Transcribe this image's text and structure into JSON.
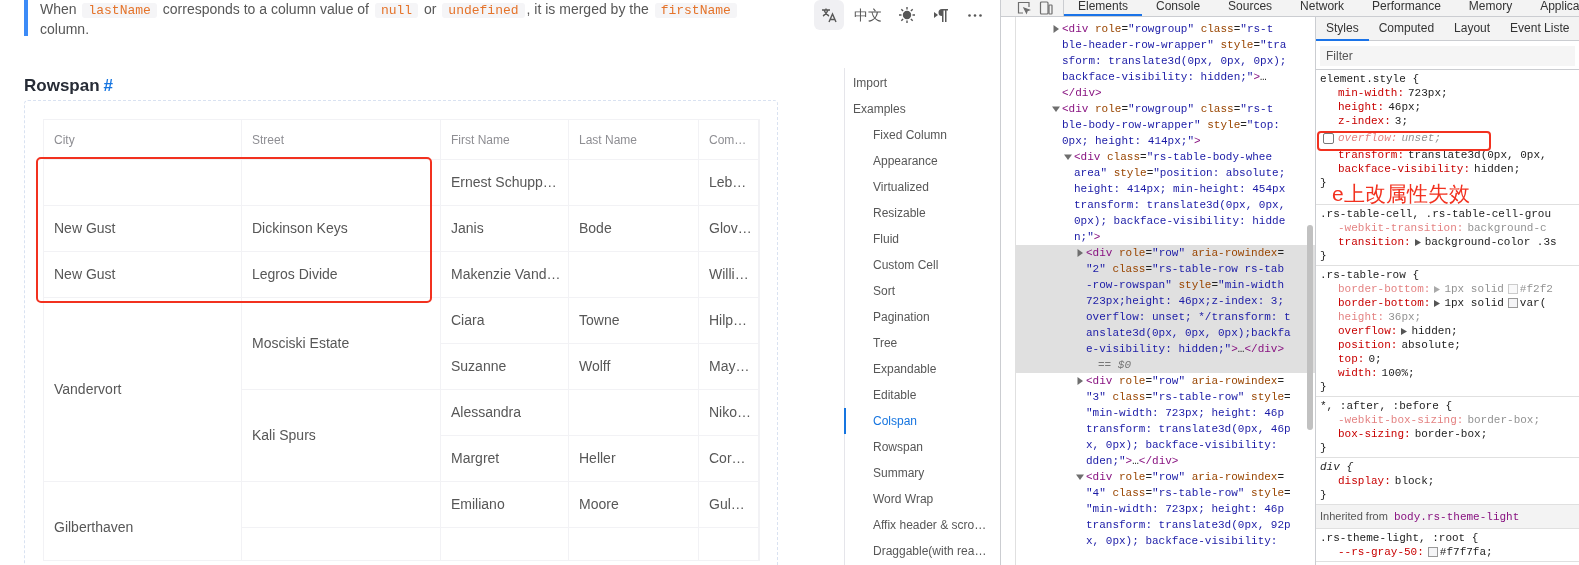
{
  "doc": {
    "note": [
      {
        "text": "When "
      },
      {
        "code": "lastName"
      },
      {
        "text": " corresponds to a column value of "
      },
      {
        "code": "null"
      },
      {
        "text": " or "
      },
      {
        "code": "undefined"
      },
      {
        "text": ", it is merged by the "
      },
      {
        "code": "firstName"
      },
      {
        "text": " column."
      }
    ],
    "toolbar": [
      {
        "kind": "translate",
        "selected": true
      },
      {
        "kind": "language",
        "label": "中文",
        "selected": false
      },
      {
        "kind": "theme",
        "selected": false
      },
      {
        "kind": "direction",
        "selected": false
      },
      {
        "kind": "more",
        "selected": false
      }
    ],
    "heading": {
      "title": "Rowspan",
      "anchor": "#"
    },
    "table": {
      "columns": [
        "City",
        "Street",
        "First Name",
        "Last Name",
        "Com…"
      ],
      "groups": [
        {
          "streets": [
            {
              "people": [
                {
                  "first_name": "Ernest Schupp…",
                  "company": "Leb…"
                }
              ]
            }
          ]
        },
        {
          "city": "New Gust",
          "streets": [
            {
              "street": "Dickinson Keys",
              "people": [
                {
                  "first_name": "Janis",
                  "last_name": "Bode",
                  "company": "Glov…"
                }
              ]
            }
          ]
        },
        {
          "city": "New Gust",
          "streets": [
            {
              "street": "Legros Divide",
              "people": [
                {
                  "first_name": "Makenzie Vand…",
                  "company": "Willi…"
                }
              ]
            }
          ]
        },
        {
          "city": "Vandervort",
          "streets": [
            {
              "street": "Mosciski Estate",
              "people": [
                {
                  "first_name": "Ciara",
                  "last_name": "Towne",
                  "company": "Hilp…"
                },
                {
                  "first_name": "Suzanne",
                  "last_name": "Wolff",
                  "company": "May…"
                }
              ]
            },
            {
              "street": "Kali Spurs",
              "people": [
                {
                  "first_name": "Alessandra",
                  "company": "Niko…"
                },
                {
                  "first_name": "Margret",
                  "last_name": "Heller",
                  "company": "Cor…"
                }
              ]
            }
          ]
        },
        {
          "city": "Gilberthaven",
          "streets": [
            {
              "people": [
                {
                  "first_name": "Emiliano",
                  "last_name": "Moore",
                  "company": "Gul…"
                }
              ]
            }
          ]
        }
      ]
    },
    "toc": [
      {
        "label": "Import",
        "selected": false
      },
      {
        "label": "Examples",
        "selected": false,
        "children": [
          {
            "label": "Fixed Column",
            "selected": false
          },
          {
            "label": "Appearance",
            "selected": false
          },
          {
            "label": "Virtualized",
            "selected": false
          },
          {
            "label": "Resizable",
            "selected": false
          },
          {
            "label": "Fluid",
            "selected": false
          },
          {
            "label": "Custom Cell",
            "selected": false
          },
          {
            "label": "Sort",
            "selected": false
          },
          {
            "label": "Pagination",
            "selected": false
          },
          {
            "label": "Tree",
            "selected": false
          },
          {
            "label": "Expandable",
            "selected": false
          },
          {
            "label": "Editable",
            "selected": false
          },
          {
            "label": "Colspan",
            "selected": true
          },
          {
            "label": "Rowspan",
            "selected": false
          },
          {
            "label": "Summary",
            "selected": false
          },
          {
            "label": "Word Wrap",
            "selected": false
          },
          {
            "label": "Affix header & scro…",
            "selected": false
          },
          {
            "label": "Draggable(with rea…",
            "selected": false
          }
        ]
      }
    ]
  },
  "devtools": {
    "tools": [
      {
        "kind": "inspect"
      },
      {
        "kind": "device"
      }
    ],
    "tabs": [
      {
        "label": "Elements",
        "selected": true
      },
      {
        "label": "Console",
        "selected": false
      },
      {
        "label": "Sources",
        "selected": false
      },
      {
        "label": "Network",
        "selected": false
      },
      {
        "label": "Performance",
        "selected": false
      },
      {
        "label": "Memory",
        "selected": false
      },
      {
        "label": "Applica",
        "selected": false
      }
    ],
    "dom": [
      {
        "expanded": false,
        "selected": false,
        "lines": [
          "<div role=\"rowgroup\" class=\"rs-t",
          "ble-header-row-wrapper\" style=\"tra",
          "sform: translate3d(0px, 0px, 0px);",
          "backface-visibility: hidden;\">…",
          "</div>"
        ]
      },
      {
        "expanded": true,
        "selected": false,
        "lines": [
          "<div role=\"rowgroup\" class=\"rs-t",
          "ble-body-row-wrapper\" style=\"top:",
          "0px; height: 414px;\">"
        ],
        "children": [
          {
            "expanded": true,
            "selected": false,
            "lines": [
              "<div class=\"rs-table-body-whee",
              "area\" style=\"position: absolute;",
              "height: 414px; min-height: 454px",
              "transform: translate3d(0px, 0px,",
              "0px); backface-visibility: hidde",
              "n;\">"
            ],
            "children": [
              {
                "expanded": false,
                "selected": true,
                "ref": "== $0",
                "lines": [
                  "<div role=\"row\" aria-rowindex=",
                  "\"2\" class=\"rs-table-row rs-tab",
                  "-row-rowspan\" style=\"min-width",
                  "723px;height: 46px;z-index: 3;",
                  "overflow: unset; */transform: t",
                  "anslate3d(0px, 0px, 0px);backfa",
                  "e-visibility: hidden;\">…</div>"
                ]
              },
              {
                "expanded": false,
                "selected": false,
                "lines": [
                  "<div role=\"row\" aria-rowindex=",
                  "\"3\" class=\"rs-table-row\" style=",
                  "\"min-width: 723px; height: 46p",
                  "transform: translate3d(0px, 46p",
                  "x, 0px); backface-visibility:",
                  "dden;\">…</div>"
                ]
              },
              {
                "expanded": true,
                "selected": false,
                "lines": [
                  "<div role=\"row\" aria-rowindex=",
                  "\"4\" class=\"rs-table-row\" style=",
                  "\"min-width: 723px; height: 46p",
                  "transform: translate3d(0px, 92p",
                  "x, 0px); backface-visibility:"
                ]
              }
            ]
          }
        ]
      }
    ],
    "styles": {
      "tabs": [
        {
          "label": "Styles",
          "selected": true
        },
        {
          "label": "Computed",
          "selected": false
        },
        {
          "label": "Layout",
          "selected": false
        },
        {
          "label": "Event Liste",
          "selected": false
        }
      ],
      "filter": {
        "placeholder": "Filter"
      },
      "rules": [
        {
          "kind": "rule",
          "selector": "element.style {",
          "user_agent": false,
          "close": "}",
          "declarations": [
            {
              "name": "min-width:",
              "value": "723px;",
              "overridden": false,
              "enabled": true,
              "expandable": false,
              "swatch": false
            },
            {
              "name": "height:",
              "value": "46px;",
              "overridden": false,
              "enabled": true,
              "expandable": false,
              "swatch": false
            },
            {
              "name": "z-index:",
              "value": "3;",
              "overridden": false,
              "enabled": true,
              "expandable": false,
              "swatch": false
            },
            {
              "name": "overflow:",
              "value": "unset;",
              "overridden": true,
              "enabled": false,
              "expandable": false,
              "swatch": false
            },
            {
              "name": "transform:",
              "value": "translate3d(0px, 0px,",
              "overridden": false,
              "enabled": true,
              "expandable": false,
              "swatch": false
            },
            {
              "name": "backface-visibility:",
              "value": "hidden;",
              "overridden": false,
              "enabled": true,
              "expandable": false,
              "swatch": false
            }
          ]
        },
        {
          "kind": "rule",
          "selector": ".rs-table-cell, .rs-table-cell-grou",
          "user_agent": false,
          "close": "}",
          "declarations": [
            {
              "name": "-webkit-transition:",
              "value": "background-c",
              "overridden": true,
              "enabled": true,
              "expandable": false,
              "swatch": false
            },
            {
              "name": "transition:",
              "value": "background-color .3s",
              "overridden": false,
              "enabled": true,
              "expandable": true,
              "swatch": false
            }
          ]
        },
        {
          "kind": "rule",
          "selector": ".rs-table-row {",
          "user_agent": false,
          "close": "}",
          "declarations": [
            {
              "name": "border-bottom:",
              "value": "1px solid",
              "overridden": true,
              "enabled": true,
              "expandable": true,
              "swatch": true,
              "swatch_text": "#f2f2"
            },
            {
              "name": "border-bottom:",
              "value": "1px solid",
              "overridden": false,
              "enabled": true,
              "expandable": true,
              "swatch": true,
              "swatch_text": "var("
            },
            {
              "name": "height:",
              "value": "36px;",
              "overridden": true,
              "enabled": true,
              "expandable": false,
              "swatch": false
            },
            {
              "name": "overflow:",
              "value": "hidden;",
              "overridden": false,
              "enabled": true,
              "expandable": true,
              "swatch": false
            },
            {
              "name": "position:",
              "value": "absolute;",
              "overridden": false,
              "enabled": true,
              "expandable": false,
              "swatch": false
            },
            {
              "name": "top:",
              "value": "0;",
              "overridden": false,
              "enabled": true,
              "expandable": false,
              "swatch": false
            },
            {
              "name": "width:",
              "value": "100%;",
              "overridden": false,
              "enabled": true,
              "expandable": false,
              "swatch": false
            }
          ]
        },
        {
          "kind": "rule",
          "selector": "*, :after, :before {",
          "user_agent": false,
          "close": "}",
          "declarations": [
            {
              "name": "-webkit-box-sizing:",
              "value": "border-box;",
              "overridden": true,
              "enabled": true,
              "expandable": false,
              "swatch": false
            },
            {
              "name": "box-sizing:",
              "value": "border-box;",
              "overridden": false,
              "enabled": true,
              "expandable": false,
              "swatch": false
            }
          ]
        },
        {
          "kind": "rule",
          "selector": "div {",
          "user_agent": true,
          "close": "}",
          "declarations": [
            {
              "name": "display:",
              "value": "block;",
              "overridden": false,
              "enabled": true,
              "expandable": false,
              "swatch": false
            }
          ]
        },
        {
          "kind": "inherited",
          "label": "Inherited from",
          "selector": "body.rs-theme-light"
        },
        {
          "kind": "rule",
          "selector": ".rs-theme-light, :root {",
          "user_agent": false,
          "declarations": [
            {
              "name": "--rs-gray-50:",
              "overridden": false,
              "enabled": true,
              "expandable": false,
              "swatch": true,
              "swatch_text": "#f7f7fa;"
            }
          ]
        }
      ]
    },
    "annotation": {
      "text": "e上改属性失效"
    }
  }
}
